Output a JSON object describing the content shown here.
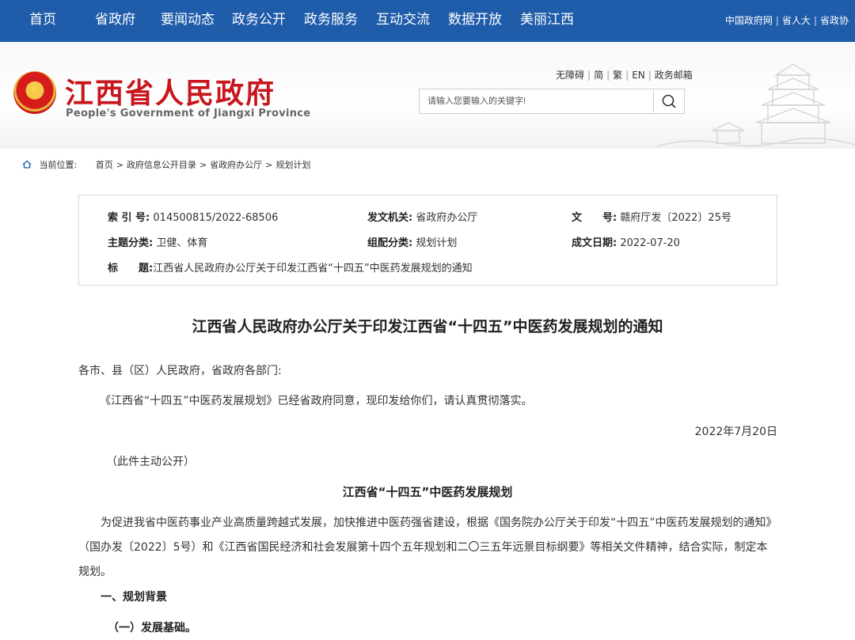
{
  "topnav": {
    "items": [
      "首页",
      "省政府",
      "要闻动态",
      "政务公开",
      "政务服务",
      "互动交流",
      "数据开放",
      "美丽江西"
    ],
    "right_links": [
      "中国政府网",
      "省人大",
      "省政协"
    ]
  },
  "header": {
    "title": "江西省人民政府",
    "subtitle": "People's Government of Jiangxi Province",
    "util_links": [
      "无障碍",
      "简",
      "繁",
      "EN",
      "政务邮箱"
    ],
    "search_placeholder": "请输入您要输入的关键字!"
  },
  "breadcrumb": {
    "label": "当前位置:",
    "items": [
      "首页",
      "政府信息公开目录",
      "省政府办公厅",
      "规划计划"
    ]
  },
  "meta": {
    "index_label": "索 引 号:",
    "index_value": "014500815/2022-68506",
    "issuer_label": "发文机关:",
    "issuer_value": "省政府办公厅",
    "docno_label": "文　　号:",
    "docno_value": "赣府厅发〔2022〕25号",
    "topic_label": "主题分类:",
    "topic_value": "卫健、体育",
    "category_label": "组配分类:",
    "category_value": "规划计划",
    "date_label": "成文日期:",
    "date_value": "2022-07-20",
    "title_label": "标　　题:",
    "title_value": "江西省人民政府办公厅关于印发江西省“十四五”中医药发展规划的通知"
  },
  "article": {
    "title": "江西省人民政府办公厅关于印发江西省“十四五”中医药发展规划的通知",
    "salutation": "各市、县（区）人民政府，省政府各部门:",
    "body1": "《江西省“十四五”中医药发展规划》已经省政府同意，现印发给你们，请认真贯彻落实。",
    "date": "2022年7月20日",
    "note": "（此件主动公开）",
    "plan_title": "江西省“十四五”中医药发展规划",
    "para1": "为促进我省中医药事业产业高质量跨越式发展，加快推进中医药强省建设，根据《国务院办公厅关于印发“十四五”中医药发展规划的通知》（国办发〔2022〕5号）和《江西省国民经济和社会发展第十四个五年规划和二〇三五年远景目标纲要》等相关文件精神，结合实际，制定本规划。",
    "section1": "一、规划背景",
    "section1_1": "（一）发展基础。"
  }
}
